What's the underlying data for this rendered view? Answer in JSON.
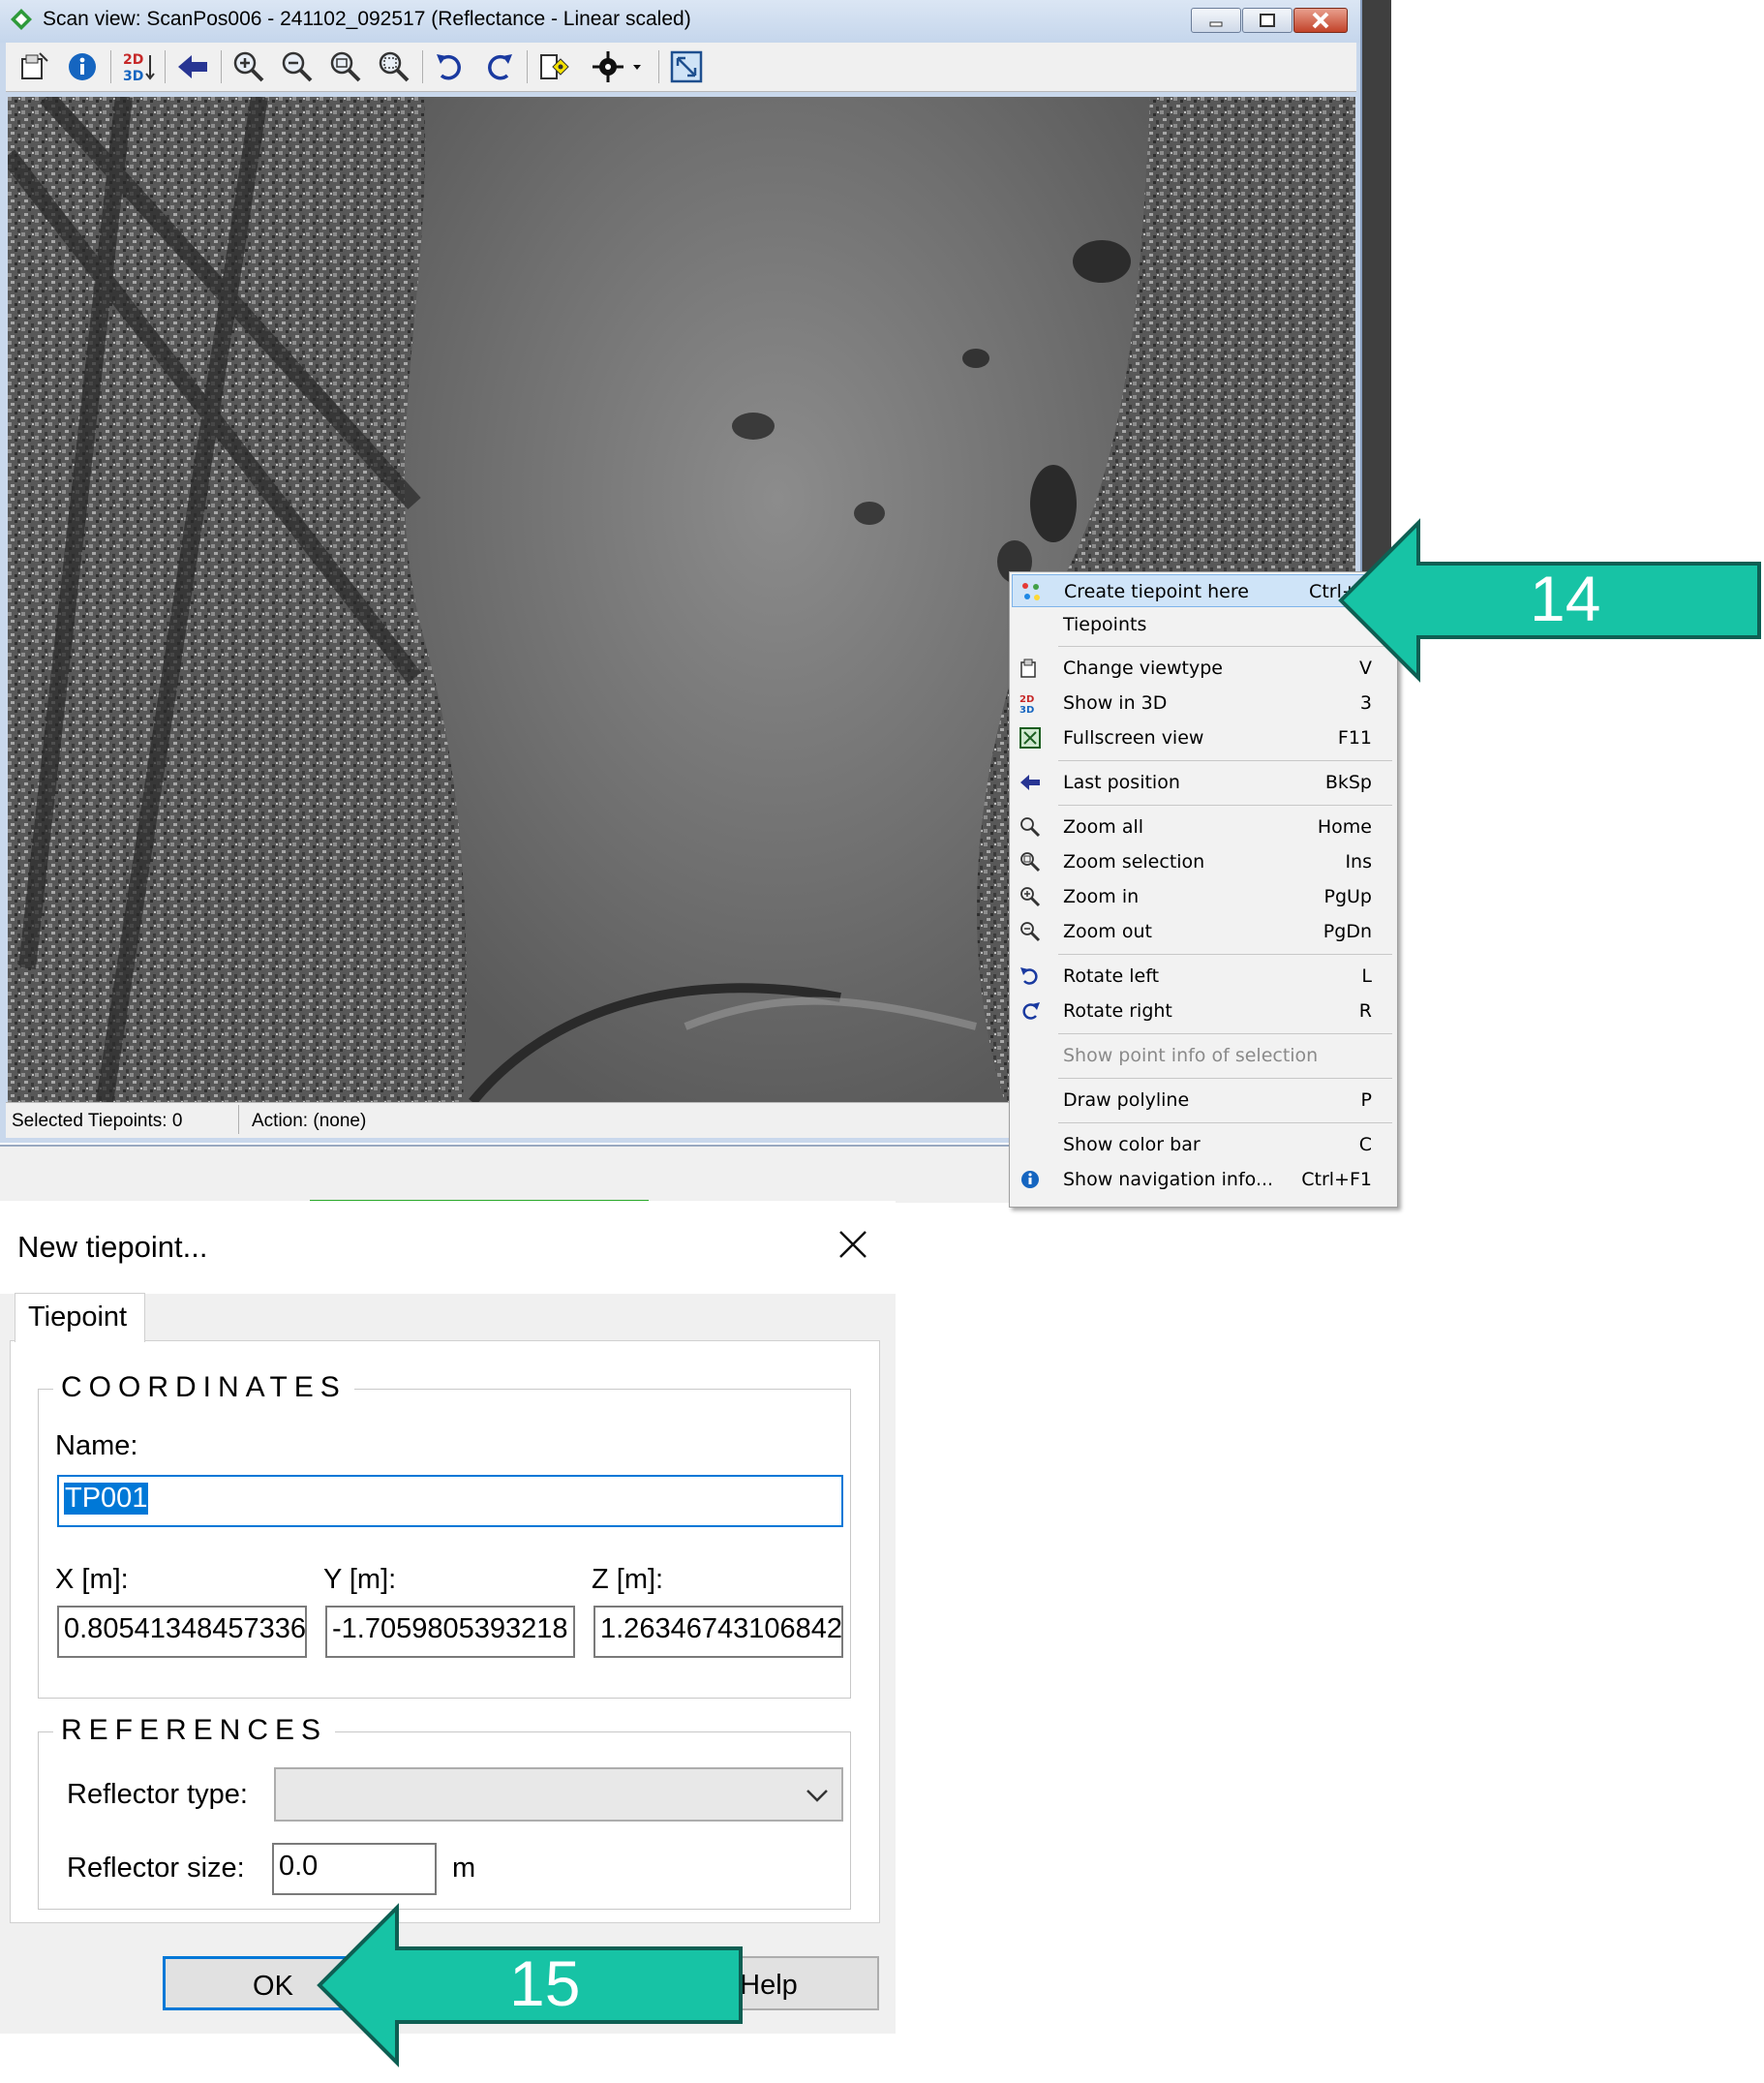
{
  "scan_window": {
    "title": "Scan view: ScanPos006 - 241102_092517 (Reflectance - Linear scaled)",
    "toolbar_icons": [
      "viewtype-icon",
      "info-icon",
      "2d-3d-icon",
      "back-arrow-icon",
      "zoom-in-icon",
      "zoom-out-icon",
      "zoom-all-icon",
      "zoom-selection-icon",
      "rotate-left-icon",
      "rotate-right-icon",
      "tiepoint-icon",
      "crosshair-icon",
      "fullscreen-icon"
    ],
    "status": {
      "selected_tiepoints": "Selected Tiepoints: 0",
      "action": "Action: (none)"
    }
  },
  "context_menu": {
    "items": [
      {
        "label": "Create tiepoint here",
        "shortcut": "Ctrl+N",
        "icon": "tiepoint-icon",
        "highlighted": true
      },
      {
        "label": "Tiepoints",
        "shortcut": "",
        "icon": ""
      },
      {
        "label": "Change viewtype",
        "shortcut": "V",
        "icon": "viewtype-icon"
      },
      {
        "label": "Show in 3D",
        "shortcut": "3",
        "icon": "2d-3d-icon"
      },
      {
        "label": "Fullscreen view",
        "shortcut": "F11",
        "icon": "fullscreen-icon"
      },
      {
        "label": "Last position",
        "shortcut": "BkSp",
        "icon": "back-arrow-icon"
      },
      {
        "label": "Zoom all",
        "shortcut": "Home",
        "icon": "zoom-all-icon"
      },
      {
        "label": "Zoom selection",
        "shortcut": "Ins",
        "icon": "zoom-selection-icon"
      },
      {
        "label": "Zoom in",
        "shortcut": "PgUp",
        "icon": "zoom-in-icon"
      },
      {
        "label": "Zoom out",
        "shortcut": "PgDn",
        "icon": "zoom-out-icon"
      },
      {
        "label": "Rotate left",
        "shortcut": "L",
        "icon": "rotate-left-icon"
      },
      {
        "label": "Rotate right",
        "shortcut": "R",
        "icon": "rotate-right-icon"
      },
      {
        "label": "Show point info of selection",
        "shortcut": "",
        "icon": "",
        "disabled": true
      },
      {
        "label": "Draw polyline",
        "shortcut": "P",
        "icon": ""
      },
      {
        "label": "Show color bar",
        "shortcut": "C",
        "icon": ""
      },
      {
        "label": "Show navigation info...",
        "shortcut": "Ctrl+F1",
        "icon": "info-icon"
      }
    ]
  },
  "dialog": {
    "title": "New tiepoint...",
    "tab": "Tiepoint",
    "coordinates": {
      "group_title": "COORDINATES",
      "name_label": "Name:",
      "name_value": "TP001",
      "x_label": "X [m]:",
      "x_value": "0.80541348457336",
      "y_label": "Y [m]:",
      "y_value": "-1.7059805393218",
      "z_label": "Z [m]:",
      "z_value": "1.26346743106842"
    },
    "references": {
      "group_title": "REFERENCES",
      "reflector_type_label": "Reflector type:",
      "reflector_type_value": "",
      "reflector_size_label": "Reflector size:",
      "reflector_size_value": "0.0",
      "reflector_size_unit": "m"
    },
    "buttons": {
      "ok": "OK",
      "help": "Help"
    }
  },
  "callouts": {
    "step14": "14",
    "step15": "15",
    "color": "#17c3a5"
  }
}
